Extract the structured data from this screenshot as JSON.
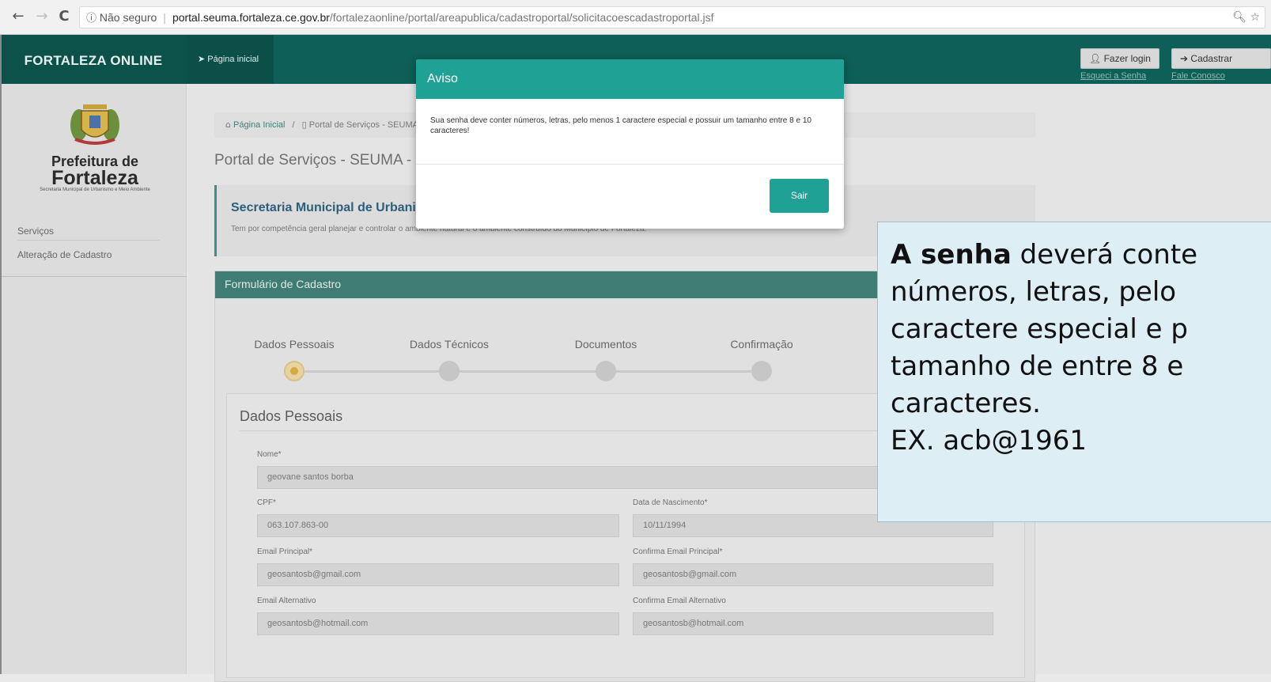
{
  "browser": {
    "back": "←",
    "forward": "→",
    "reload": "C",
    "security_icon": "ⓘ",
    "security_label": "Não seguro",
    "url_host": "portal.seuma.fortaleza.ce.gov.br",
    "url_path": "/fortalezaonline/portal/areapublica/cadastroportal/solicitacoescadastroportal.jsf",
    "zoom_icon": "🔍︎",
    "star_icon": "☆"
  },
  "header": {
    "brand": "FORTALEZA ONLINE",
    "home_link": "Página inicial",
    "login_button": "Fazer login",
    "register_button": "Cadastrar",
    "forgot_link": "Esqueci a Senha",
    "contact_link": "Fale Conosco"
  },
  "sidebar": {
    "logo_line1": "Prefeitura de",
    "logo_line2": "Fortaleza",
    "logo_line3": "Secretaria Municipal de Urbanismo e Meio Ambiente",
    "items": [
      {
        "label": "Serviços"
      },
      {
        "label": "Alteração de Cadastro"
      }
    ]
  },
  "main": {
    "breadcrumb_home": "Página Inicial",
    "breadcrumb_sep": "/",
    "breadcrumb_current": "Portal de Serviços - SEUMA",
    "page_title": "Portal de Serviços - SEUMA - P",
    "secretaria_title": "Secretaria Municipal de Urbanis",
    "secretaria_desc": "Tem por competência geral planejar e controlar o ambiente natural e o ambiente construído do Município de Fortaleza.",
    "form_header": "Formulário de Cadastro",
    "steps": [
      {
        "label": "Dados Pessoais"
      },
      {
        "label": "Dados Técnicos"
      },
      {
        "label": "Documentos"
      },
      {
        "label": "Confirmação"
      }
    ],
    "section_title": "Dados Pessoais",
    "fields": {
      "nome_label": "Nome*",
      "nome_value": "geovane santos borba",
      "cpf_label": "CPF*",
      "cpf_value": "063.107.863-00",
      "nasc_label": "Data de Nascimento*",
      "nasc_value": "10/11/1994",
      "email_label": "Email Principal*",
      "email_value": "geosantosb@gmail.com",
      "email_conf_label": "Confirma Email Principal*",
      "email_conf_value": "geosantosb@gmail.com",
      "alt_label": "Email Alternativo",
      "alt_value": "geosantosb@hotmail.com",
      "alt_conf_label": "Confirma Email Alternativo",
      "alt_conf_value": "geosantosb@hotmail.com"
    }
  },
  "dialog": {
    "title": "Aviso",
    "message": "Sua senha deve conter números, letras, pelo menos 1 caractere especial e possuir um tamanho entre 8 e 10 caracteres!",
    "button": "Sair"
  },
  "callout": {
    "bold": "A senha",
    "line1_rest": " deverá conte",
    "line2": "números, letras, pelo",
    "line3": "caractere especial e p",
    "line4": "tamanho de entre 8 e",
    "line5": "caracteres.",
    "line6": "EX.  acb@1961"
  }
}
